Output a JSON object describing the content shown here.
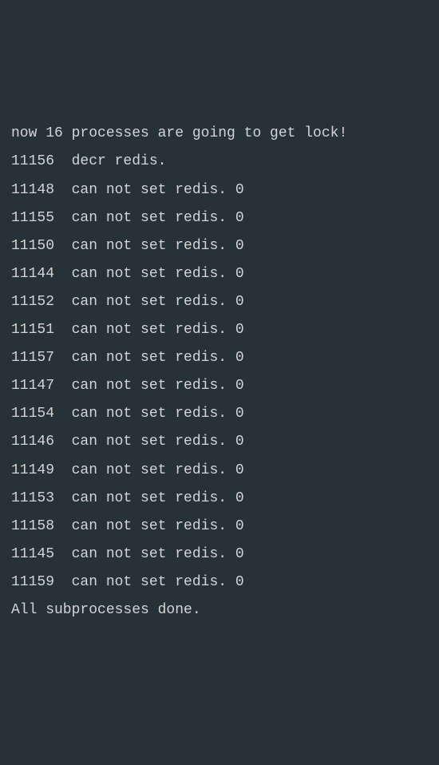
{
  "lines": [
    "now 16 processes are going to get lock!",
    "11156  decr redis.",
    "11148  can not set redis. 0",
    "11155  can not set redis. 0",
    "11150  can not set redis. 0",
    "11144  can not set redis. 0",
    "11152  can not set redis. 0",
    "11151  can not set redis. 0",
    "11157  can not set redis. 0",
    "11147  can not set redis. 0",
    "11154  can not set redis. 0",
    "11146  can not set redis. 0",
    "11149  can not set redis. 0",
    "11153  can not set redis. 0",
    "11158  can not set redis. 0",
    "11145  can not set redis. 0",
    "11159  can not set redis. 0",
    "All subprocesses done."
  ]
}
